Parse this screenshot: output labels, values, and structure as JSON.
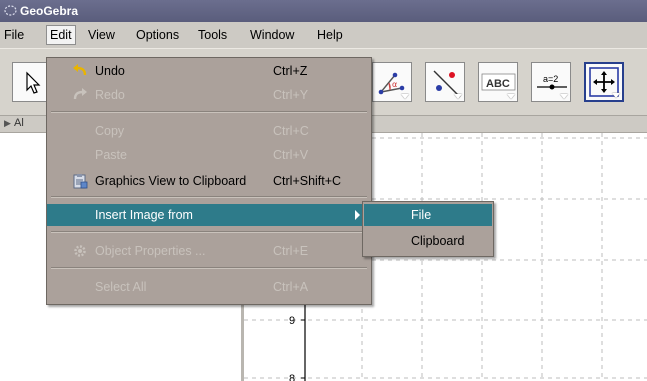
{
  "window": {
    "title": "GeoGebra"
  },
  "menubar": {
    "items": [
      "File",
      "Edit",
      "View",
      "Options",
      "Tools",
      "Window",
      "Help"
    ],
    "active": "Edit"
  },
  "viewbar": {
    "label": "Al"
  },
  "edit_menu": {
    "items": [
      {
        "label": "Undo",
        "shortcut": "Ctrl+Z",
        "enabled": true,
        "icon": "undo-icon"
      },
      {
        "label": "Redo",
        "shortcut": "Ctrl+Y",
        "enabled": false,
        "icon": "redo-icon"
      },
      {
        "label": "Copy",
        "shortcut": "Ctrl+C",
        "enabled": false
      },
      {
        "label": "Paste",
        "shortcut": "Ctrl+V",
        "enabled": false
      },
      {
        "label": "Graphics View to Clipboard",
        "shortcut": "Ctrl+Shift+C",
        "enabled": true,
        "icon": "clipboard-icon"
      },
      {
        "label": "Insert Image from",
        "shortcut": "",
        "enabled": true,
        "highlighted": true,
        "submenu": true
      },
      {
        "label": "Object Properties ...",
        "shortcut": "Ctrl+E",
        "enabled": false,
        "icon": "gear-icon"
      },
      {
        "label": "Select All",
        "shortcut": "Ctrl+A",
        "enabled": false
      }
    ]
  },
  "insert_image_submenu": {
    "items": [
      {
        "label": "File",
        "highlighted": true
      },
      {
        "label": "Clipboard",
        "highlighted": false
      }
    ]
  },
  "toolbar": {
    "tools": [
      {
        "name": "move-tool",
        "icon": "cursor-arrow-icon"
      },
      {
        "name": "angle-tool",
        "icon": "angle-icon"
      },
      {
        "name": "reflect-tool",
        "icon": "reflect-about-line-icon"
      },
      {
        "name": "text-tool",
        "icon": "text-icon",
        "text": "ABC"
      },
      {
        "name": "slider-tool",
        "icon": "slider-icon",
        "text": "a=2"
      },
      {
        "name": "move-graphics-view-tool",
        "icon": "move-graphics-view-icon",
        "selected": true
      }
    ]
  },
  "graphics": {
    "y_tick_labels": [
      "9",
      "8"
    ],
    "accent_color": "#2e7b8a"
  }
}
